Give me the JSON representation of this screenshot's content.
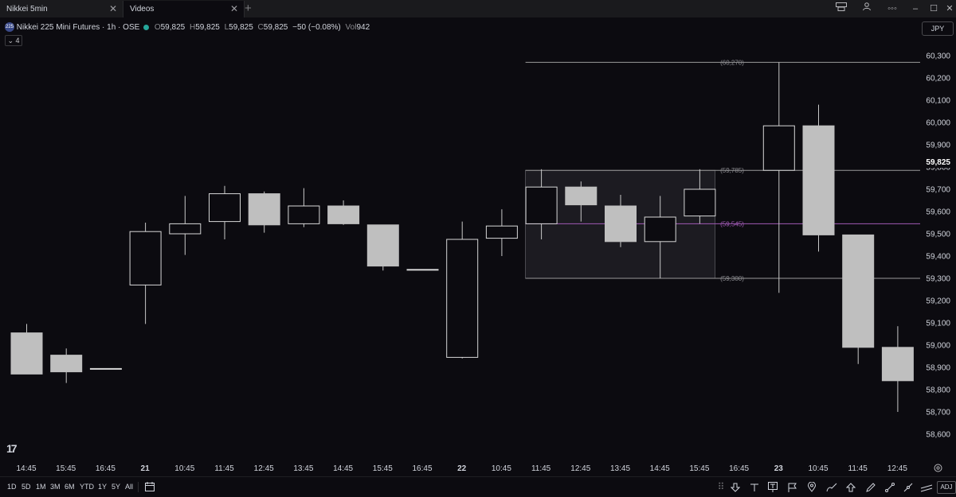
{
  "window": {
    "tabs": [
      {
        "label": "Nikkei 5min",
        "active": false
      },
      {
        "label": "Videos",
        "active": true
      }
    ],
    "new_tab": "+",
    "controls": {
      "layout": "layout-icon",
      "more": "◦◦◦",
      "minimize": "–",
      "maximize": "☐",
      "close": "✕"
    }
  },
  "legend": {
    "badge": "225",
    "title": "Nikkei 225 Mini Futures · 1h · OSE",
    "open_label": "O",
    "open": "59,825",
    "high_label": "H",
    "high": "59,825",
    "low_label": "L",
    "low": "59,825",
    "close_label": "C",
    "close": "59,825",
    "change": "−50 (−0.08%)",
    "vol_label": "Vol",
    "vol": "942",
    "collapse_label": "⌄ 4"
  },
  "currency": "JPY",
  "colors": {
    "background": "#0c0b10",
    "candle_fill": "#bfbfbf",
    "candle_outline": "#d7d7d7",
    "hline": "#9a9a9a",
    "fib_mid": "#a05ab4",
    "zone": "#2a2a30"
  },
  "chart_data": {
    "type": "candlestick",
    "symbol": "Nikkei 225 Mini Futures",
    "interval": "1h",
    "ylim": [
      58550,
      60300
    ],
    "yticks": [
      58600,
      58700,
      58800,
      58900,
      59000,
      59100,
      59200,
      59300,
      59400,
      59500,
      59600,
      59700,
      59800,
      59900,
      60000,
      60100,
      60200,
      60300
    ],
    "ytick_labels": [
      "58,600",
      "58,700",
      "58,800",
      "58,900",
      "59,000",
      "59,100",
      "59,200",
      "59,300",
      "59,400",
      "59,500",
      "59,600",
      "59,700",
      "59,800",
      "59,900",
      "60,000",
      "60,100",
      "60,200",
      "60,300"
    ],
    "xticks": [
      {
        "label": "14:45",
        "bold": false
      },
      {
        "label": "15:45",
        "bold": false
      },
      {
        "label": "16:45",
        "bold": false
      },
      {
        "label": "21",
        "bold": true
      },
      {
        "label": "10:45",
        "bold": false
      },
      {
        "label": "11:45",
        "bold": false
      },
      {
        "label": "12:45",
        "bold": false
      },
      {
        "label": "13:45",
        "bold": false
      },
      {
        "label": "14:45",
        "bold": false
      },
      {
        "label": "15:45",
        "bold": false
      },
      {
        "label": "16:45",
        "bold": false
      },
      {
        "label": "22",
        "bold": true
      },
      {
        "label": "10:45",
        "bold": false
      },
      {
        "label": "11:45",
        "bold": false
      },
      {
        "label": "12:45",
        "bold": false
      },
      {
        "label": "13:45",
        "bold": false
      },
      {
        "label": "14:45",
        "bold": false
      },
      {
        "label": "15:45",
        "bold": false
      },
      {
        "label": "16:45",
        "bold": false
      },
      {
        "label": "23",
        "bold": true
      },
      {
        "label": "10:45",
        "bold": false
      },
      {
        "label": "11:45",
        "bold": false
      },
      {
        "label": "12:45",
        "bold": false
      }
    ],
    "candles": [
      {
        "o": 59055,
        "h": 59095,
        "l": 58870,
        "c": 58870
      },
      {
        "o": 58955,
        "h": 58985,
        "l": 58830,
        "c": 58880
      },
      {
        "o": 58895,
        "h": 58895,
        "l": 58895,
        "c": 58895
      },
      {
        "o": 59270,
        "h": 59550,
        "l": 59095,
        "c": 59510
      },
      {
        "o": 59500,
        "h": 59670,
        "l": 59405,
        "c": 59545
      },
      {
        "o": 59555,
        "h": 59715,
        "l": 59475,
        "c": 59680
      },
      {
        "o": 59680,
        "h": 59690,
        "l": 59505,
        "c": 59540
      },
      {
        "o": 59545,
        "h": 59705,
        "l": 59530,
        "c": 59625
      },
      {
        "o": 59625,
        "h": 59650,
        "l": 59540,
        "c": 59545
      },
      {
        "o": 59540,
        "h": 59540,
        "l": 59335,
        "c": 59355
      },
      {
        "o": 59340,
        "h": 59340,
        "l": 59340,
        "c": 59340
      },
      {
        "o": 58945,
        "h": 59555,
        "l": 58940,
        "c": 59475
      },
      {
        "o": 59480,
        "h": 59610,
        "l": 59400,
        "c": 59535
      },
      {
        "o": 59545,
        "h": 59790,
        "l": 59475,
        "c": 59710
      },
      {
        "o": 59710,
        "h": 59735,
        "l": 59555,
        "c": 59630
      },
      {
        "o": 59625,
        "h": 59675,
        "l": 59440,
        "c": 59465
      },
      {
        "o": 59465,
        "h": 59670,
        "l": 59300,
        "c": 59575
      },
      {
        "o": 59580,
        "h": 59790,
        "l": 59545,
        "c": 59700
      },
      null,
      {
        "o": 59785,
        "h": 60270,
        "l": 59235,
        "c": 59985
      },
      {
        "o": 59985,
        "h": 60080,
        "l": 59420,
        "c": 59495
      },
      {
        "o": 59495,
        "h": 59495,
        "l": 58915,
        "c": 58990
      },
      {
        "o": 58990,
        "h": 59085,
        "l": 58700,
        "c": 58840
      }
    ],
    "levels": [
      {
        "value": 60270,
        "label": "(60,270)",
        "x_from": 13
      },
      {
        "value": 59785,
        "label": "(59,785)",
        "x_from": 13
      },
      {
        "value": 59545,
        "label": "(59,545)",
        "x_from": 13
      },
      {
        "value": 59300,
        "label": "(59,300)",
        "x_from": 13
      }
    ],
    "zone": {
      "from": 13,
      "to": 17,
      "low": 59300,
      "high": 59785
    },
    "last_price": 59825,
    "last_price_label": "59,825"
  },
  "toolbar": {
    "ranges": [
      "1D",
      "5D",
      "1M",
      "3M",
      "6M",
      "YTD",
      "1Y",
      "5Y",
      "All"
    ],
    "calendar_icon": "calendar-icon",
    "drawing_tools": [
      "grip-icon",
      "arrow-down-icon",
      "text-icon",
      "pin-text-icon",
      "flag-icon",
      "location-pin-icon",
      "brush-icon",
      "arrow-up-icon",
      "pencil-icon",
      "trend-line-icon",
      "ray-icon",
      "parallel-channel-icon",
      "ruler-icon"
    ],
    "adj_label": "ADJ"
  }
}
